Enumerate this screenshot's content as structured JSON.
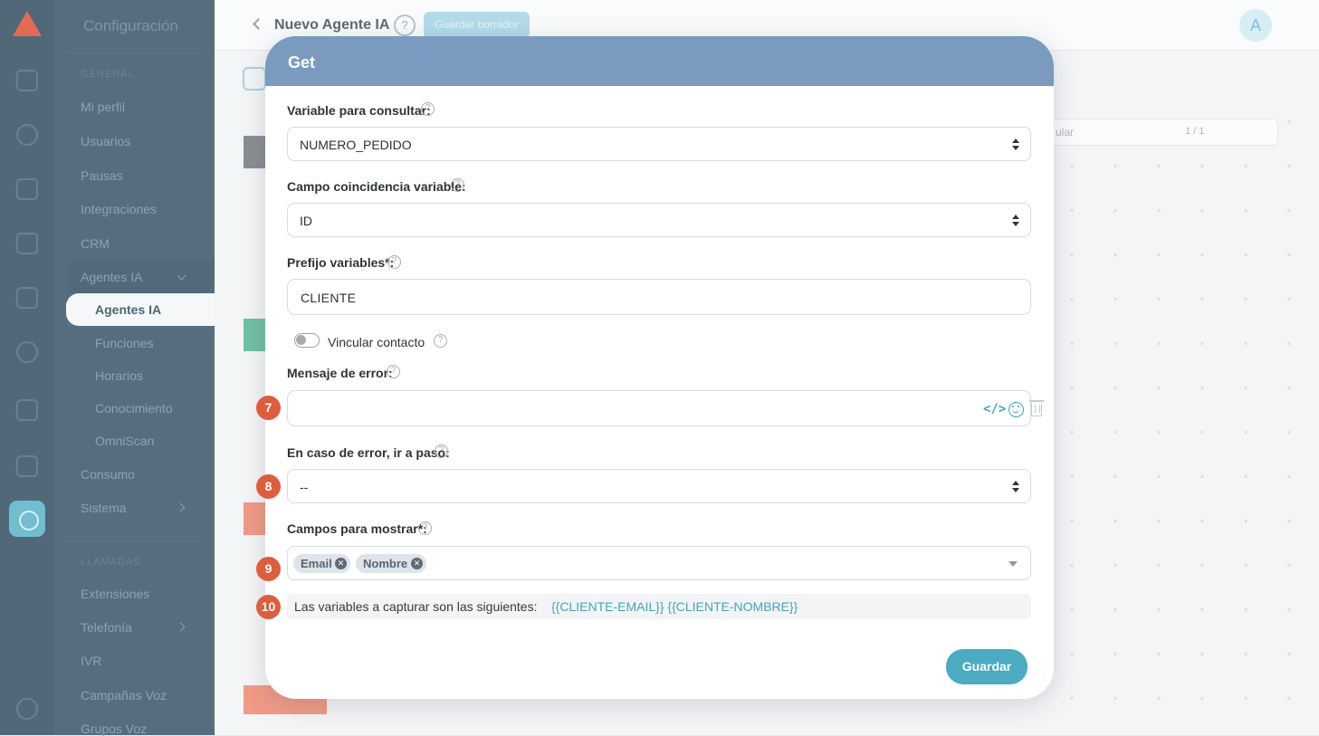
{
  "sidebar": {
    "title": "Configuración",
    "section_general": "GENERAL",
    "items": [
      "Mi perfil",
      "Usuarios",
      "Pausas",
      "Integraciones",
      "CRM",
      "Agentes IA"
    ],
    "active_label": "Agentes IA",
    "subitems": [
      "Funciones",
      "Horarios",
      "Conocimiento",
      "OmniScan"
    ],
    "items2": [
      "Consumo",
      "Sistema"
    ],
    "section_llamadas": "LLAMADAS",
    "items3": [
      "Extensiones",
      "Telefonía",
      "IVR",
      "Campañas Voz",
      "Grupos Voz"
    ]
  },
  "header": {
    "title": "Nuevo Agente IA",
    "draft_label": "Guardar borrador",
    "avatar": "A",
    "search_text": "ular",
    "search_count": "1 / 1"
  },
  "modal": {
    "title": "Get",
    "variable_label": "Variable para consultar:",
    "variable_value": "NUMERO_PEDIDO",
    "match_label": "Campo coincidencia variable:",
    "match_value": "ID",
    "prefix_label": "Prefijo variables*:",
    "prefix_value": "CLIENTE",
    "link_contact_label": "Vincular contacto",
    "link_contact_on": false,
    "error_msg_label": "Mensaje de error:",
    "error_msg_value": "",
    "error_step_label": "En caso de error, ir a paso:",
    "error_step_value": "--",
    "fields_label": "Campos para mostrar*:",
    "fields_tags": [
      "Email",
      "Nombre"
    ],
    "info_text": "Las variables a capturar son las siguientes:",
    "info_vars": "{{CLIENTE-EMAIL}} {{CLIENTE-NOMBRE}}",
    "save_label": "Guardar",
    "help_glyph": "?",
    "code_glyph": "</>"
  },
  "badges": [
    "7",
    "8",
    "9",
    "10"
  ],
  "colors": {
    "modal_header": "#7b9ac0",
    "accent": "#4aabc3",
    "badge": "#dd5d3d",
    "sidebar": "#3e596d"
  }
}
